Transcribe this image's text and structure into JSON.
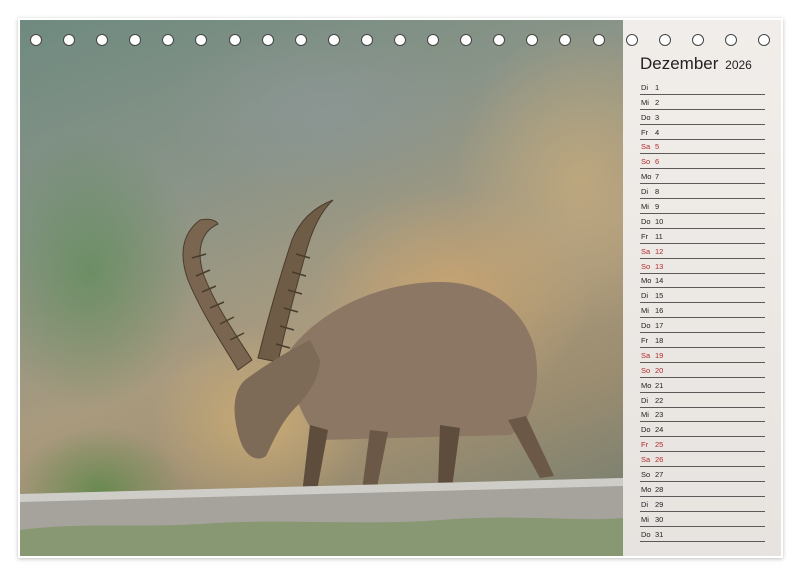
{
  "calendar": {
    "month": "Dezember",
    "year": "2026",
    "days": [
      {
        "wd": "Di",
        "d": "1",
        "weekend": false
      },
      {
        "wd": "Mi",
        "d": "2",
        "weekend": false
      },
      {
        "wd": "Do",
        "d": "3",
        "weekend": false
      },
      {
        "wd": "Fr",
        "d": "4",
        "weekend": false
      },
      {
        "wd": "Sa",
        "d": "5",
        "weekend": true
      },
      {
        "wd": "So",
        "d": "6",
        "weekend": true
      },
      {
        "wd": "Mo",
        "d": "7",
        "weekend": false
      },
      {
        "wd": "Di",
        "d": "8",
        "weekend": false
      },
      {
        "wd": "Mi",
        "d": "9",
        "weekend": false
      },
      {
        "wd": "Do",
        "d": "10",
        "weekend": false
      },
      {
        "wd": "Fr",
        "d": "11",
        "weekend": false
      },
      {
        "wd": "Sa",
        "d": "12",
        "weekend": true
      },
      {
        "wd": "So",
        "d": "13",
        "weekend": true
      },
      {
        "wd": "Mo",
        "d": "14",
        "weekend": false
      },
      {
        "wd": "Di",
        "d": "15",
        "weekend": false
      },
      {
        "wd": "Mi",
        "d": "16",
        "weekend": false
      },
      {
        "wd": "Do",
        "d": "17",
        "weekend": false
      },
      {
        "wd": "Fr",
        "d": "18",
        "weekend": false
      },
      {
        "wd": "Sa",
        "d": "19",
        "weekend": true
      },
      {
        "wd": "So",
        "d": "20",
        "weekend": true
      },
      {
        "wd": "Mo",
        "d": "21",
        "weekend": false
      },
      {
        "wd": "Di",
        "d": "22",
        "weekend": false
      },
      {
        "wd": "Mi",
        "d": "23",
        "weekend": false
      },
      {
        "wd": "Do",
        "d": "24",
        "weekend": false
      },
      {
        "wd": "Fr",
        "d": "25",
        "weekend": true
      },
      {
        "wd": "Sa",
        "d": "26",
        "weekend": true
      },
      {
        "wd": "So",
        "d": "27",
        "weekend": false
      },
      {
        "wd": "Mo",
        "d": "28",
        "weekend": false
      },
      {
        "wd": "Di",
        "d": "29",
        "weekend": false
      },
      {
        "wd": "Mi",
        "d": "30",
        "weekend": false
      },
      {
        "wd": "Do",
        "d": "31",
        "weekend": false
      }
    ]
  },
  "colors": {
    "weekend_text": "#b1282b",
    "rule_line": "#5a5a5a"
  },
  "binding_hole_count": 23
}
